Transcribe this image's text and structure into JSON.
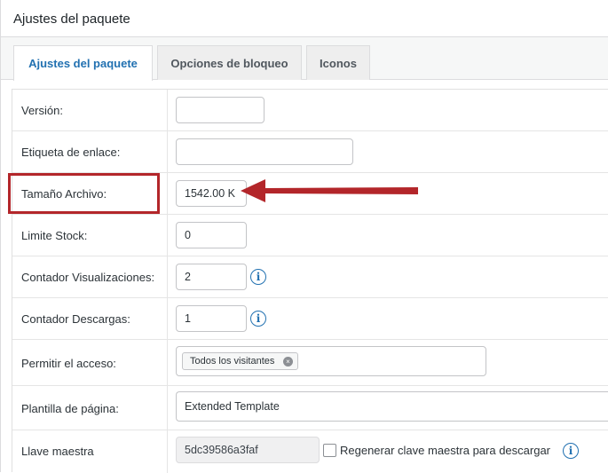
{
  "panel": {
    "title": "Ajustes del paquete"
  },
  "tabs": [
    {
      "label": "Ajustes del paquete",
      "active": true
    },
    {
      "label": "Opciones de bloqueo",
      "active": false
    },
    {
      "label": "Iconos",
      "active": false
    }
  ],
  "fields": {
    "version": {
      "label": "Versión:",
      "value": ""
    },
    "link_label": {
      "label": "Etiqueta de enlace:",
      "value": ""
    },
    "file_size": {
      "label": "Tamaño Archivo:",
      "value": "1542.00 K"
    },
    "stock_limit": {
      "label": "Limite Stock:",
      "value": "0"
    },
    "view_count": {
      "label": "Contador Visualizaciones:",
      "value": "2"
    },
    "download_count": {
      "label": "Contador Descargas:",
      "value": "1"
    },
    "access": {
      "label": "Permitir el acceso:",
      "chip": "Todos los visitantes"
    },
    "page_template": {
      "label": "Plantilla de página:",
      "value": "Extended Template"
    },
    "master_key": {
      "label": "Llave maestra",
      "value": "5dc39586a3faf",
      "regenerate_label": "Regenerar clave maestra para descargar"
    }
  },
  "icons": {
    "info": "info-icon",
    "remove_chip": "close-circle-icon",
    "annotation": "red-arrow"
  },
  "colors": {
    "accent": "#2271b1",
    "annotation": "#b3262a"
  }
}
